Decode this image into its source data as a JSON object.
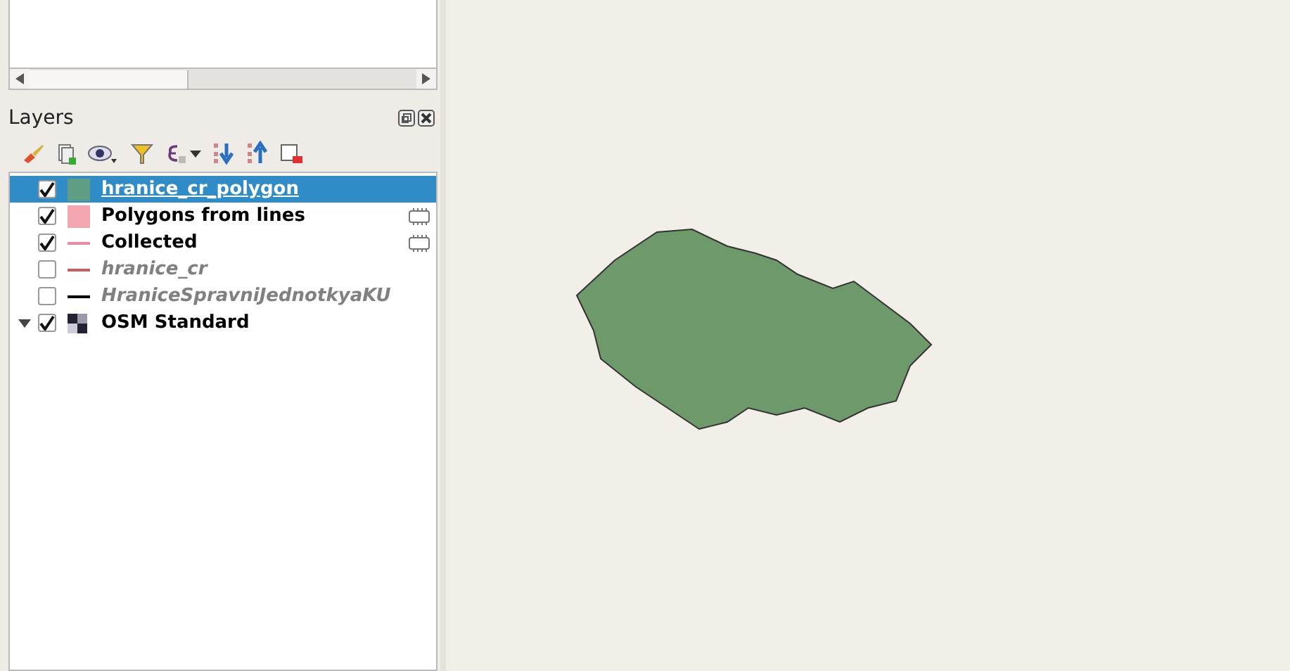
{
  "layers_panel": {
    "title": "Layers",
    "layers": [
      {
        "name": "hranice_cr_polygon",
        "checked": true,
        "selected": true,
        "kind": "fill",
        "color": "#5f9e84",
        "indicator": false
      },
      {
        "name": "Polygons from lines",
        "checked": true,
        "selected": false,
        "kind": "fill",
        "color": "#f4a6b0",
        "indicator": true
      },
      {
        "name": "Collected",
        "checked": true,
        "selected": false,
        "kind": "line",
        "color": "#f08aa0",
        "indicator": true
      },
      {
        "name": "hranice_cr",
        "checked": false,
        "selected": false,
        "kind": "line",
        "color": "#c06060",
        "indicator": false
      },
      {
        "name": "HraniceSpravniJednotkyaKU",
        "checked": false,
        "selected": false,
        "kind": "line",
        "color": "#000000",
        "indicator": false
      },
      {
        "name": "OSM Standard",
        "checked": true,
        "selected": false,
        "kind": "raster",
        "indicator": false
      }
    ]
  }
}
